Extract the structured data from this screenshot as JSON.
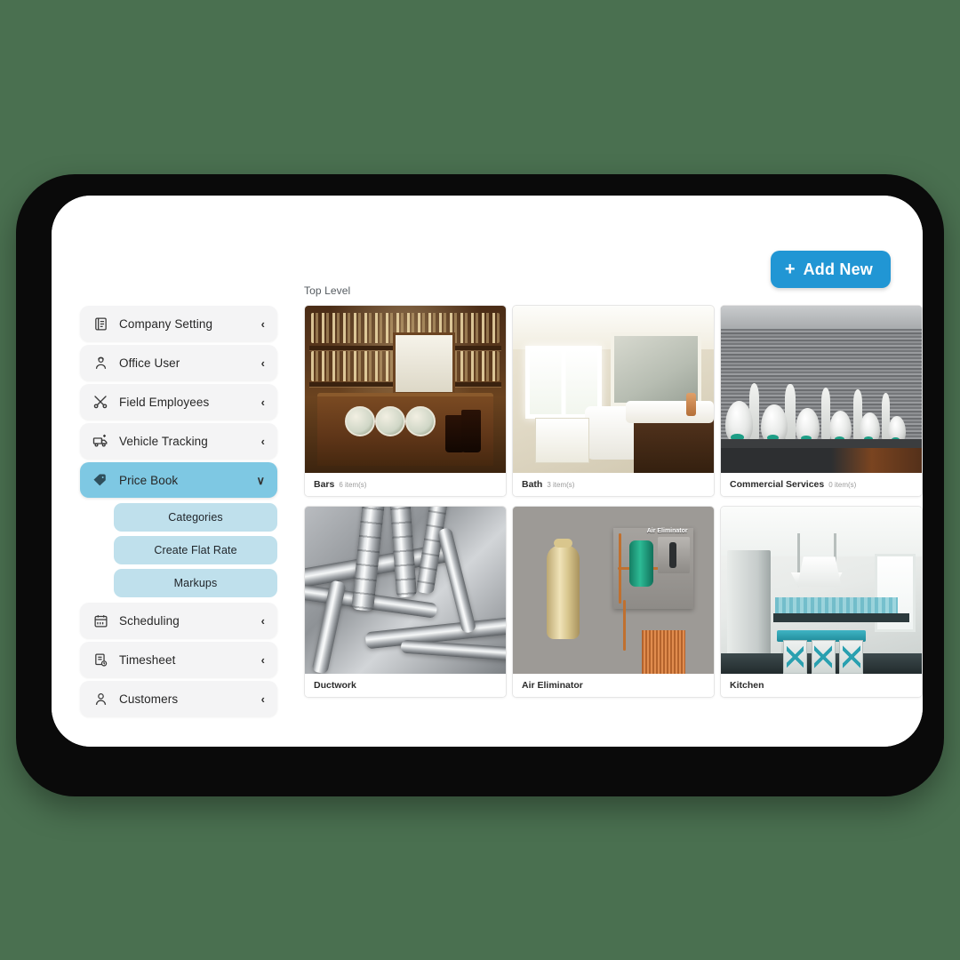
{
  "theme": {
    "page_background": "#4a7050",
    "device_bezel": "#0a0a0a",
    "screen_background": "#ffffff",
    "accent_blue": "#2196d4",
    "active_nav_blue": "#7ec8e3",
    "submenu_blue": "#bfe0ec",
    "nav_item_gray": "#f4f4f5"
  },
  "toolbar": {
    "add_new_label": "Add New",
    "add_new_icon": "plus-icon"
  },
  "content": {
    "breadcrumb": "Top Level",
    "cards": [
      {
        "title": "Bars",
        "count": "6 item(s)",
        "image": "pub-bar-interior"
      },
      {
        "title": "Bath",
        "count": "3 item(s)",
        "image": "bathroom-interior"
      },
      {
        "title": "Commercial Services",
        "count": "0 item(s)",
        "image": "commercial-restroom-urinals"
      },
      {
        "title": "Ductwork",
        "count": "",
        "image": "hvac-ductwork"
      },
      {
        "title": "Air Eliminator",
        "count": "",
        "image": "air-eliminator-equipment"
      },
      {
        "title": "Kitchen",
        "count": "",
        "image": "modern-kitchen-interior"
      }
    ],
    "image_labels": {
      "air_eliminator": "Air Eliminator"
    }
  },
  "sidebar": {
    "items": [
      {
        "label": "Company Setting",
        "icon": "document-icon",
        "chevron": "‹",
        "active": false
      },
      {
        "label": "Office User",
        "icon": "user-headset-icon",
        "chevron": "‹",
        "active": false
      },
      {
        "label": "Field Employees",
        "icon": "tools-icon",
        "chevron": "‹",
        "active": false
      },
      {
        "label": "Vehicle Tracking",
        "icon": "truck-icon",
        "chevron": "‹",
        "active": false
      },
      {
        "label": "Price Book",
        "icon": "price-tag-icon",
        "chevron": "∨",
        "active": true
      }
    ],
    "submenu": [
      {
        "label": "Categories"
      },
      {
        "label": "Create Flat Rate"
      },
      {
        "label": "Markups"
      }
    ],
    "items_bottom": [
      {
        "label": "Scheduling",
        "icon": "calendar-icon",
        "chevron": "‹"
      },
      {
        "label": "Timesheet",
        "icon": "timesheet-icon",
        "chevron": "‹"
      },
      {
        "label": "Customers",
        "icon": "person-icon",
        "chevron": "‹"
      }
    ]
  }
}
